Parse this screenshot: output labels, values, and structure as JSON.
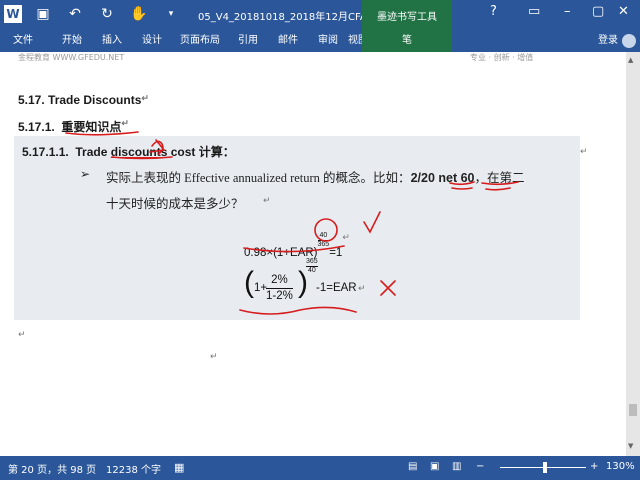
{
  "window": {
    "title": "05_V4_20181018_2018年12月CFA一级...",
    "ink_tools_label": "墨迹书写工具",
    "help": "?",
    "login": "登录"
  },
  "ribbon": {
    "tabs": [
      "文件",
      "开始",
      "插入",
      "设计",
      "页面布局",
      "引用",
      "邮件",
      "审阅",
      "视图",
      "笔"
    ]
  },
  "document": {
    "header_left": "金程教育 WWW.GFEDU.NET",
    "header_right": "专业 · 创新 · 增值",
    "h1": "5.17.   Trade Discounts",
    "h2_num": "5.17.1.",
    "h2_text": "重要知识点",
    "h3_num": "5.17.1.1.",
    "h3_text_a": "Trade ",
    "h3_text_b": "discounts",
    "h3_text_c": " cost 计算：",
    "bullet": "➢",
    "body_line1_a": "实际上表现的 Effective annualized return 的概念。比如：",
    "body_line1_b": "2/20",
    "body_line1_c": " net 60",
    "body_line1_d": "，在第二",
    "body_line2": "十天时候的成本是多少？",
    "formula1_base": "0.98×(1+EAR)",
    "formula1_num": "40",
    "formula1_den": "365",
    "formula1_tail": "=1",
    "formula2_open": "(",
    "formula2_one": "1+",
    "formula2_num": "2%",
    "formula2_den": "1-2%",
    "formula2_close": ")",
    "formula2_exp_num": "365",
    "formula2_exp_den": "40",
    "formula2_tail": "-1=EAR",
    "ink_marks": {
      "check": "✓",
      "cross": "X",
      "note": "学"
    }
  },
  "status": {
    "page": "第 20 页，共 98 页",
    "words": "12238 个字",
    "zoom": "130%"
  },
  "colors": {
    "ribbon": "#2b579a",
    "ink_tab": "#217346",
    "ink": "#d61c1c",
    "shade": "#e8ecf1"
  },
  "zoom_level": 0.5
}
